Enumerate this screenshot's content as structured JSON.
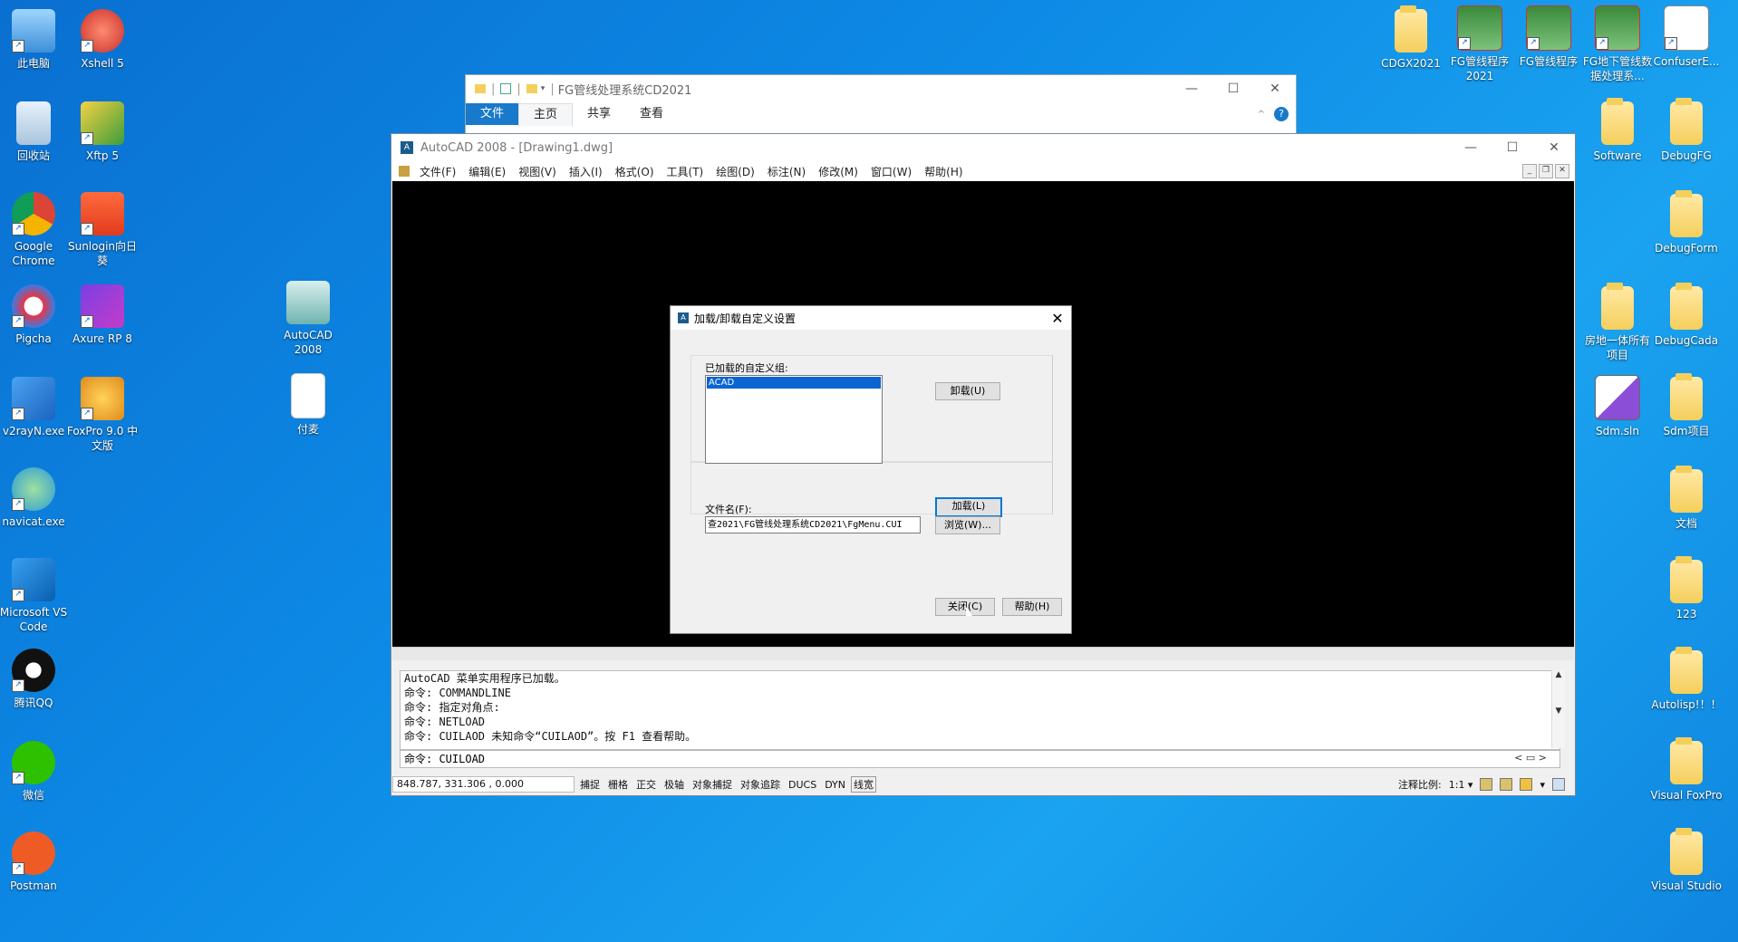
{
  "desktop": {
    "left_icons": [
      {
        "label": "此电脑",
        "icon": "computer-icon"
      },
      {
        "label": "Xshell 5",
        "icon": "xshell-icon"
      },
      {
        "label": "回收站",
        "icon": "recycle-bin-icon"
      },
      {
        "label": "Xftp 5",
        "icon": "xftp-icon"
      },
      {
        "label": "Google Chrome",
        "icon": "chrome-icon"
      },
      {
        "label": "Sunlogin向日葵",
        "icon": "sunlogin-icon"
      },
      {
        "label": "Pigcha",
        "icon": "pigcha-icon"
      },
      {
        "label": "Axure RP 8",
        "icon": "axure-icon"
      },
      {
        "label": "v2rayN.exe",
        "icon": "v2rayn-icon"
      },
      {
        "label": "FoxPro 9.0 中文版",
        "icon": "foxpro-icon"
      },
      {
        "label": "navicat.exe",
        "icon": "navicat-icon"
      },
      {
        "label": "Microsoft VS Code",
        "icon": "vscode-icon"
      },
      {
        "label": "腾讯QQ",
        "icon": "qq-icon"
      },
      {
        "label": "微信",
        "icon": "wechat-icon"
      },
      {
        "label": "Postman",
        "icon": "postman-icon"
      },
      {
        "label": "AutoCAD 2008",
        "icon": "autocad-icon"
      },
      {
        "label": "付麦",
        "icon": "document-icon"
      }
    ],
    "right_icons": [
      {
        "label": "CDGX2021",
        "icon": "folder-icon"
      },
      {
        "label": "FG管线程序2021",
        "icon": "fg-app-icon"
      },
      {
        "label": "FG管线程序",
        "icon": "fg-app-icon"
      },
      {
        "label": "FG地下管线数据处理系...",
        "icon": "fg-app-icon"
      },
      {
        "label": "ConfuserE...",
        "icon": "confuser-icon"
      },
      {
        "label": "Software",
        "icon": "folder-icon"
      },
      {
        "label": "DebugFG",
        "icon": "folder-icon"
      },
      {
        "label": "DebugForm",
        "icon": "folder-icon"
      },
      {
        "label": "房地一体所有项目",
        "icon": "folder-icon"
      },
      {
        "label": "DebugCada",
        "icon": "folder-icon"
      },
      {
        "label": "Sdm.sln",
        "icon": "visual-studio-solution-icon"
      },
      {
        "label": "Sdm项目",
        "icon": "folder-icon"
      },
      {
        "label": "文档",
        "icon": "folder-icon"
      },
      {
        "label": "123",
        "icon": "folder-icon"
      },
      {
        "label": "Autolisp!！！",
        "icon": "folder-icon"
      },
      {
        "label": "Visual FoxPro",
        "icon": "folder-icon"
      },
      {
        "label": "Visual Studio",
        "icon": "folder-icon"
      }
    ]
  },
  "explorer": {
    "title": "FG管线处理系统CD2021",
    "tabs": [
      "文件",
      "主页",
      "共享",
      "查看"
    ]
  },
  "autocad": {
    "title": "AutoCAD 2008 - [Drawing1.dwg]",
    "menus": [
      "文件(F)",
      "编辑(E)",
      "视图(V)",
      "插入(I)",
      "格式(O)",
      "工具(T)",
      "绘图(D)",
      "标注(N)",
      "修改(M)",
      "窗口(W)",
      "帮助(H)"
    ],
    "command_history": [
      "AutoCAD 菜单实用程序已加载。",
      "命令: COMMANDLINE",
      "命令: 指定对角点:",
      "命令: NETLOAD",
      "命令: CUILAOD 未知命令“CUILAOD”。按 F1 查看帮助。"
    ],
    "command_line": "命令: CUILOAD",
    "status": {
      "coords": "848.787, 331.306 , 0.000",
      "toggles": [
        "捕捉",
        "栅格",
        "正交",
        "极轴",
        "对象捕捉",
        "对象追踪",
        "DUCS",
        "DYN",
        "线宽"
      ],
      "annotation_scale_label": "注释比例:",
      "annotation_scale_value": "1:1"
    }
  },
  "dialog": {
    "title": "加载/卸载自定义设置",
    "loaded_groups_label": "已加载的自定义组:",
    "loaded_groups": [
      "ACAD"
    ],
    "unload_button": "卸载(U)",
    "load_button": "加载(L)",
    "filename_label": "文件名(F):",
    "filename_value": "查2021\\FG管线处理系统CD2021\\FgMenu.CUI",
    "browse_button": "浏览(W)...",
    "close_button": "关闭(C)",
    "help_button": "帮助(H)"
  }
}
